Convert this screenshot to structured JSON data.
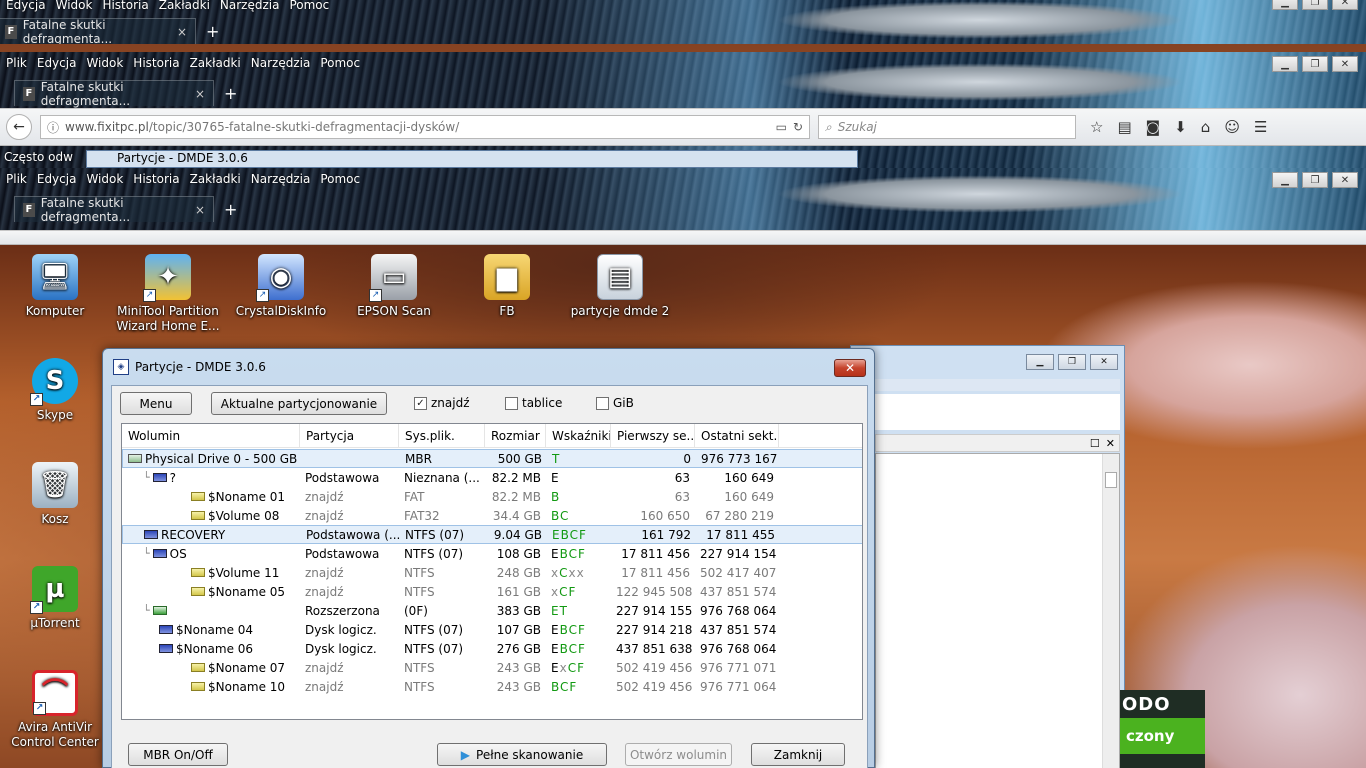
{
  "ghost_top": {
    "menu": [
      "Edycja",
      "Widok",
      "Historia",
      "Zakładki",
      "Narzędzia",
      "Pomoc"
    ],
    "tab_title": "Fatalne skutki defragmenta..."
  },
  "browser": {
    "menu": [
      "Plik",
      "Edycja",
      "Widok",
      "Historia",
      "Zakładki",
      "Narzędzia",
      "Pomoc"
    ],
    "tab_title": "Fatalne skutki defragmenta...",
    "tab_close": "×",
    "new_tab": "+",
    "win_minimize": "▁",
    "win_restore": "❐",
    "win_close": "✕",
    "url_host": "www.fixitpc.pl",
    "url_path": "/topic/30765-fatalne-skutki-defragmentacji-dysków/",
    "search_placeholder": "Szukaj",
    "side_item": "Często odw",
    "embedded_title": "Partycje - DMDE 3.0.6"
  },
  "desktop_icons": [
    {
      "label": "Komputer"
    },
    {
      "label": "MiniTool Partition Wizard Home E..."
    },
    {
      "label": "CrystalDiskInfo"
    },
    {
      "label": "EPSON Scan"
    },
    {
      "label": "FB"
    },
    {
      "label": "partycje dmde 2"
    },
    {
      "label": "Skype"
    },
    {
      "label": "Kosz"
    },
    {
      "label": "µTorrent"
    },
    {
      "label": "Avira AntiVir Control Center"
    }
  ],
  "promo": {
    "brand": "ODO",
    "text": "czony"
  },
  "dialog": {
    "title": "Partycje - DMDE 3.0.6",
    "close": "✕",
    "menu_button": "Menu",
    "current_button": "Aktualne partycjonowanie",
    "find_label": "znajdź",
    "find_checked": true,
    "tables_label": "tablice",
    "tables_checked": false,
    "gib_label": "GiB",
    "gib_checked": false,
    "columns": [
      "Wolumin",
      "Partycja",
      "Sys.plik.",
      "Rozmiar",
      "Wskaźniki",
      "Pierwszy se...",
      "Ostatni sekt..."
    ],
    "rows": [
      {
        "vol": "Physical Drive 0 - 500 GB - ...",
        "icon": "drv",
        "tree": "",
        "part": "",
        "fs": "MBR",
        "size": "500 GB",
        "ind": [
          [
            "T",
            "g"
          ]
        ],
        "first": "0",
        "last": "976 773 167",
        "grey": false,
        "sel": true
      },
      {
        "vol": "?",
        "icon": "vol",
        "tree": "└",
        "part": "Podstawowa",
        "fs": "Nieznana (...",
        "size": "82.2 MB",
        "ind": [
          [
            "E",
            "e"
          ]
        ],
        "first": "63",
        "last": "160 649",
        "grey": false,
        "sel": false
      },
      {
        "vol": "$Noname 01",
        "icon": "fnd",
        "tree": "",
        "part": "znajdź",
        "fs": "FAT",
        "size": "82.2 MB",
        "ind": [
          [
            "B",
            "g"
          ]
        ],
        "first": "63",
        "last": "160 649",
        "grey": true,
        "sel": false
      },
      {
        "vol": "$Volume 08",
        "icon": "fnd",
        "tree": "",
        "part": "znajdź",
        "fs": "FAT32",
        "size": "34.4 GB",
        "ind": [
          [
            "BC",
            "g"
          ]
        ],
        "first": "160 650",
        "last": "67 280 219",
        "grey": true,
        "sel": false
      },
      {
        "vol": "RECOVERY",
        "icon": "vol",
        "tree": "",
        "part": "Podstawowa (...",
        "fs": "NTFS (07)",
        "size": "9.04 GB",
        "ind": [
          [
            "EBCF",
            "g"
          ]
        ],
        "first": "161 792",
        "last": "17 811 455",
        "grey": false,
        "sel": true
      },
      {
        "vol": "OS",
        "icon": "vol",
        "tree": "└",
        "part": "Podstawowa",
        "fs": "NTFS (07)",
        "size": "108 GB",
        "ind": [
          [
            "E",
            "e"
          ],
          [
            "BCF",
            "g"
          ]
        ],
        "first": "17 811 456",
        "last": "227 914 154",
        "grey": false,
        "sel": false
      },
      {
        "vol": "$Volume 11",
        "icon": "fnd",
        "tree": "",
        "part": "znajdź",
        "fs": "NTFS",
        "size": "248 GB",
        "ind": [
          [
            "x",
            "x"
          ],
          [
            "C",
            "g"
          ],
          [
            "xx",
            "x"
          ]
        ],
        "first": "17 811 456",
        "last": "502 417 407",
        "grey": true,
        "sel": false
      },
      {
        "vol": "$Noname 05",
        "icon": "fnd",
        "tree": "",
        "part": "znajdź",
        "fs": "NTFS",
        "size": "161 GB",
        "ind": [
          [
            "x",
            "x"
          ],
          [
            "CF",
            "g"
          ]
        ],
        "first": "122 945 508",
        "last": "437 851 574",
        "grey": true,
        "sel": false
      },
      {
        "vol": "",
        "icon": "ext",
        "tree": "└",
        "part": "Rozszerzona",
        "fs": "(0F)",
        "size": "383 GB",
        "ind": [
          [
            "ET",
            "g"
          ]
        ],
        "first": "227 914 155",
        "last": "976 768 064",
        "grey": false,
        "sel": false
      },
      {
        "vol": "$Noname 04",
        "icon": "vol",
        "tree": "",
        "part": "Dysk logicz.",
        "fs": "NTFS (07)",
        "size": "107 GB",
        "ind": [
          [
            "E",
            "e"
          ],
          [
            "BCF",
            "g"
          ]
        ],
        "first": "227 914 218",
        "last": "437 851 574",
        "grey": false,
        "sel": false
      },
      {
        "vol": "$Noname 06",
        "icon": "vol",
        "tree": "",
        "part": "Dysk logicz.",
        "fs": "NTFS (07)",
        "size": "276 GB",
        "ind": [
          [
            "E",
            "e"
          ],
          [
            "BCF",
            "g"
          ]
        ],
        "first": "437 851 638",
        "last": "976 768 064",
        "grey": false,
        "sel": false
      },
      {
        "vol": "$Noname 07",
        "icon": "fnd",
        "tree": "",
        "part": "znajdź",
        "fs": "NTFS",
        "size": "243 GB",
        "ind": [
          [
            "E",
            "e"
          ],
          [
            "x",
            "x"
          ],
          [
            "CF",
            "g"
          ]
        ],
        "first": "502 419 456",
        "last": "976 771 071",
        "grey": true,
        "sel": false
      },
      {
        "vol": "$Noname 10",
        "icon": "fnd",
        "tree": "",
        "part": "znajdź",
        "fs": "NTFS",
        "size": "243 GB",
        "ind": [
          [
            "BCF",
            "g"
          ]
        ],
        "first": "502 419 456",
        "last": "976 771 064",
        "grey": true,
        "sel": false
      }
    ],
    "mbr_button": "MBR On/Off",
    "full_scan_button": "Pełne skanowanie",
    "open_volume_button": "Otwórz wolumin",
    "close_button": "Zamknij"
  }
}
